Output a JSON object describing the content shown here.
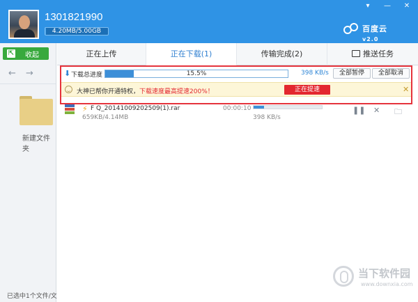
{
  "header": {
    "username": "1301821990",
    "quota_text": "4.20MB/5.00GB",
    "quota_used_fraction": 0.01,
    "logo_text": "百度云",
    "logo_version": "v2.0",
    "window_controls": [
      "▾",
      "—",
      "✕"
    ]
  },
  "sidebar": {
    "collapse_label": "收起",
    "back_arrow": "←",
    "forward_arrow": "→",
    "folder_label": "新建文件夹",
    "status_text": "已选中1个文件/文件"
  },
  "tabs": [
    {
      "label": "正在上传",
      "active": false
    },
    {
      "label": "正在下载(1)",
      "active": true
    },
    {
      "label": "传输完成(2)",
      "active": false
    },
    {
      "label": "推送任务",
      "active": false
    }
  ],
  "progress": {
    "label": "下载总进度",
    "percent_text": "15.5%",
    "percent_value": 15.5,
    "speed": "398 KB/s",
    "pause_all": "全部暂停",
    "cancel_all": "全部取消"
  },
  "notice": {
    "text": "大神已帮你开通特权，",
    "highlight": "下载速度最高提速200%！",
    "button": "正在提速",
    "close": "✕"
  },
  "task": {
    "name": "F Q_20141009202509(1).rar",
    "size": "659KB/4.14MB",
    "elapsed": "00:00:10",
    "speed": "398 KB/s",
    "progress_fraction": 0.155,
    "pause_icon": "❚❚",
    "delete_icon": "✕",
    "folder_icon": "🗀"
  },
  "watermark": {
    "text": "当下软件园",
    "url": "www.downxia.com"
  },
  "colors": {
    "header_blue": "#2f93e5",
    "accent_red": "#e3272f",
    "collapse_green": "#38a93d",
    "progress_blue": "#3d8fd8"
  }
}
